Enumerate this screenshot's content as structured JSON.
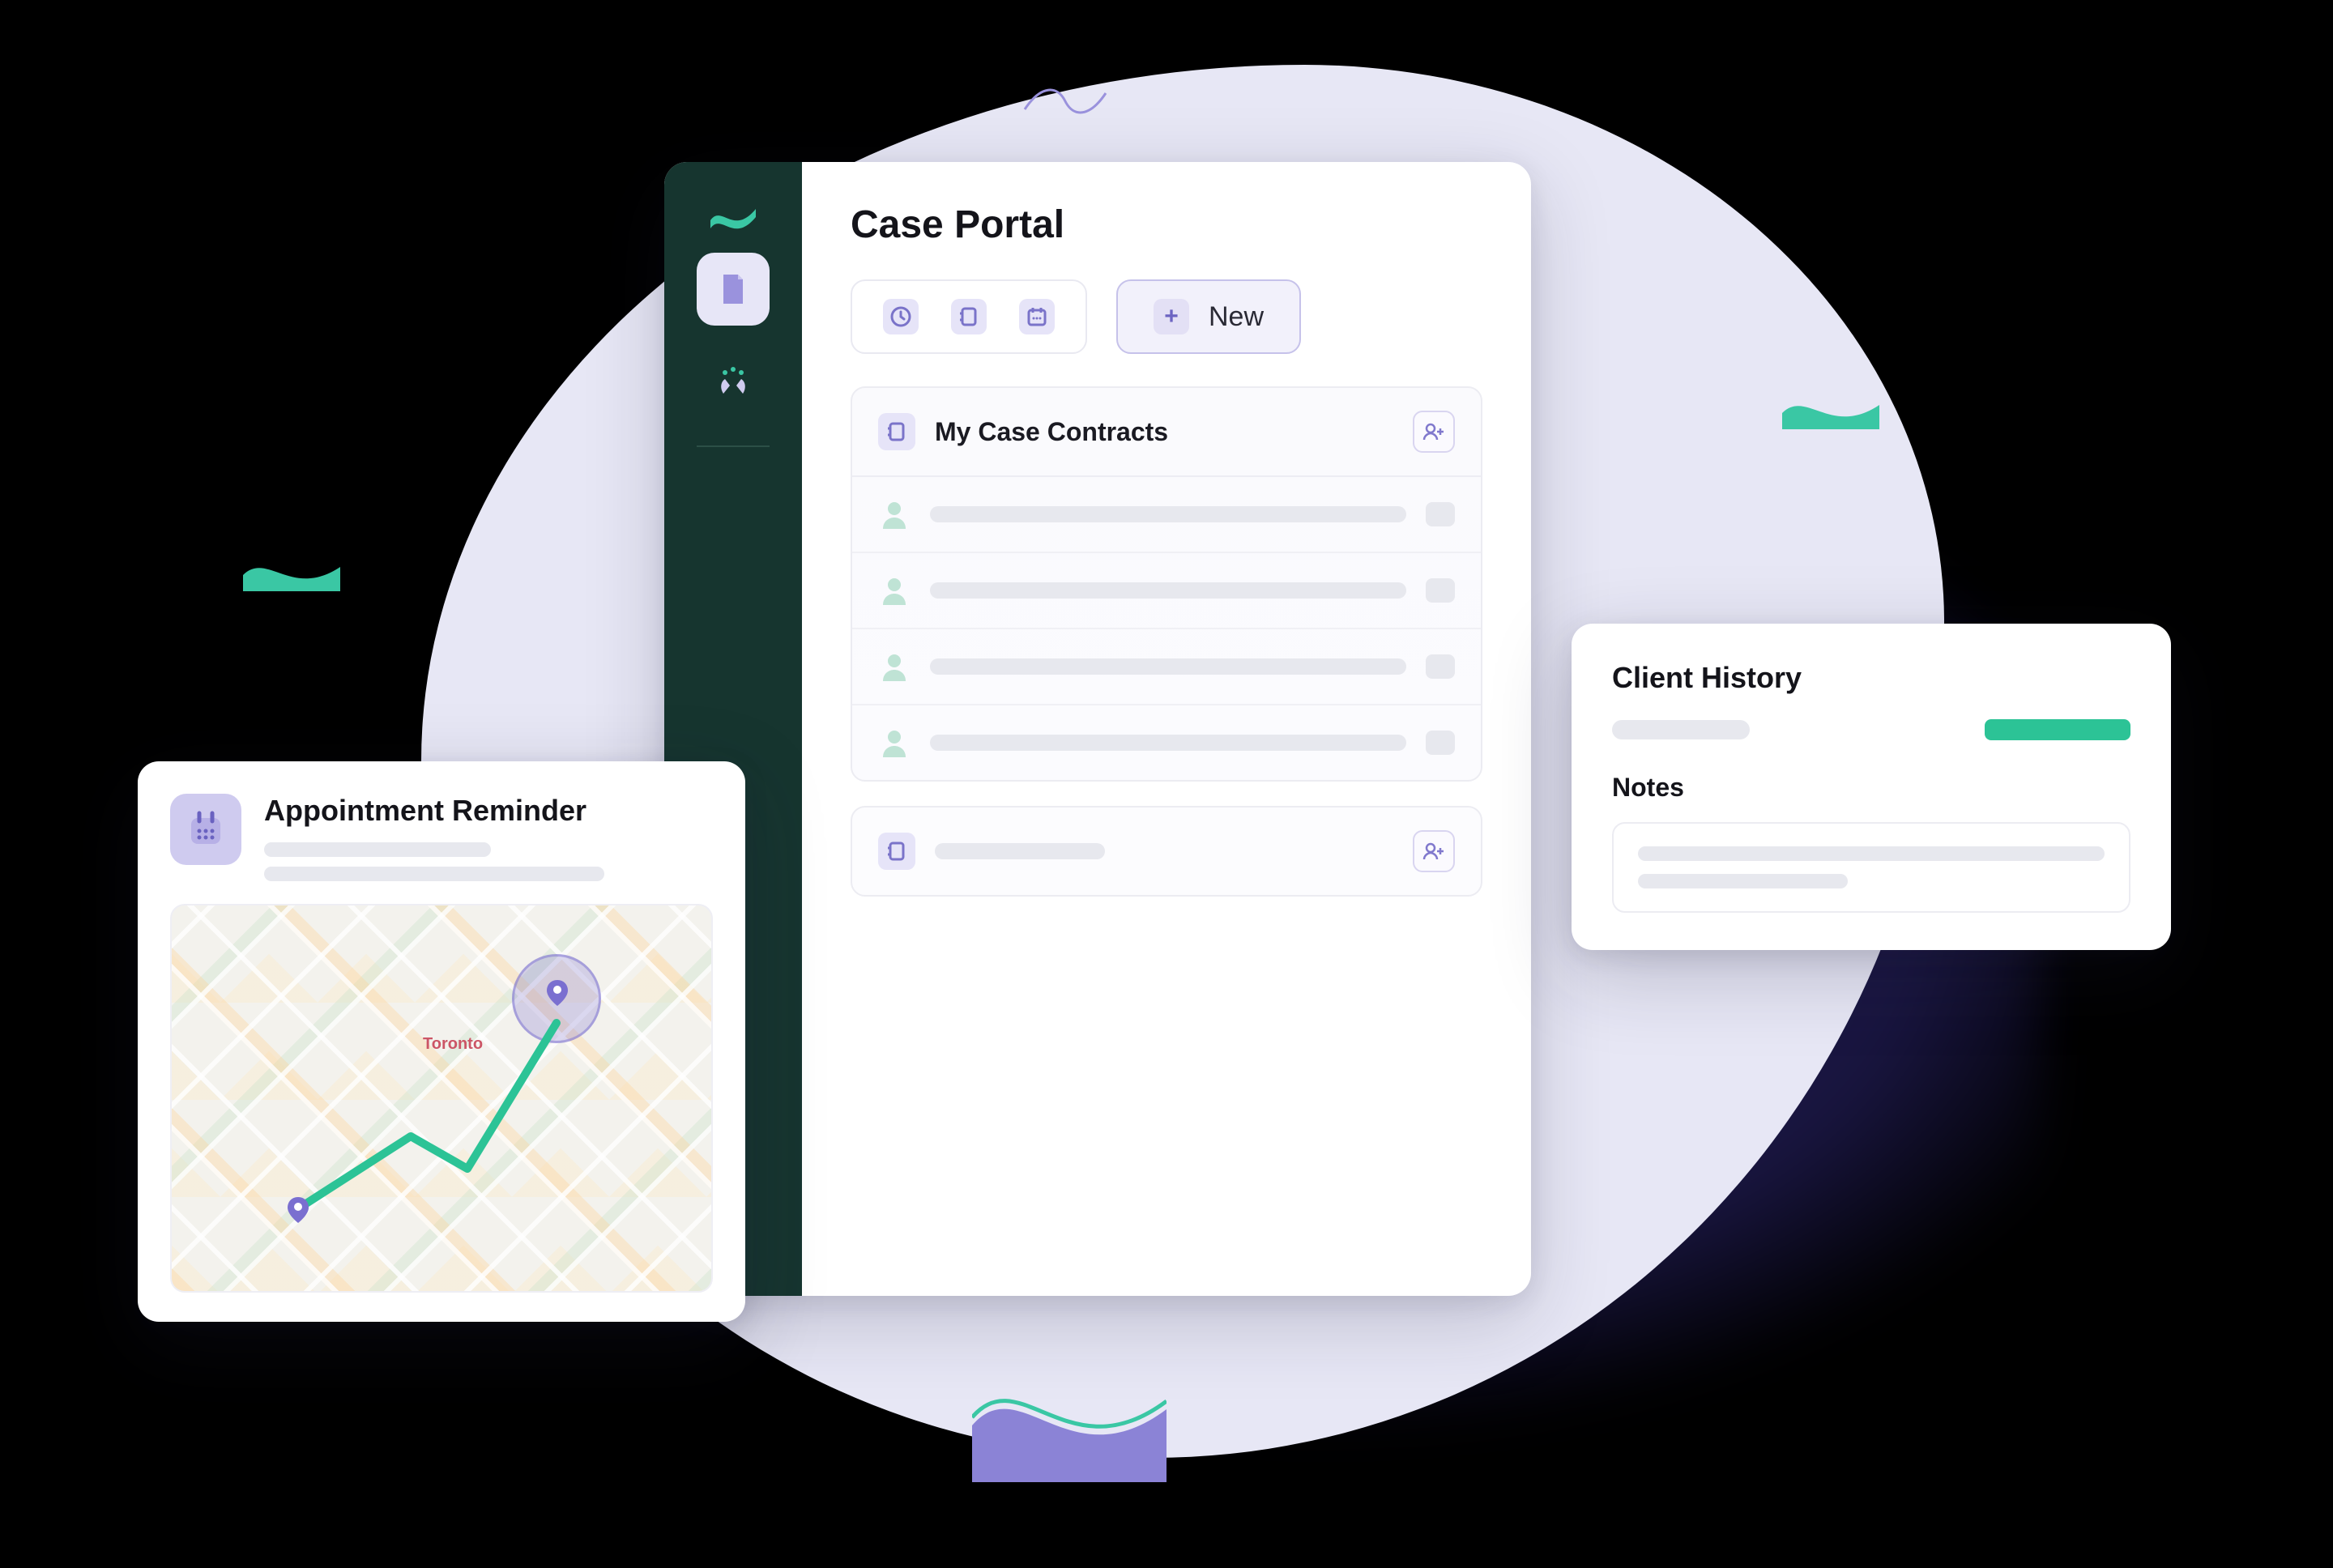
{
  "portal": {
    "title": "Case Portal",
    "new_button": "New",
    "section1_title": "My Case Contracts"
  },
  "appointment": {
    "title": "Appointment Reminder",
    "map_city_label": "Toronto"
  },
  "client": {
    "title": "Client History",
    "notes_title": "Notes"
  },
  "colors": {
    "accent_purple": "#8179cd",
    "accent_teal": "#3ac7a4",
    "sidebar_bg": "#16352f"
  }
}
